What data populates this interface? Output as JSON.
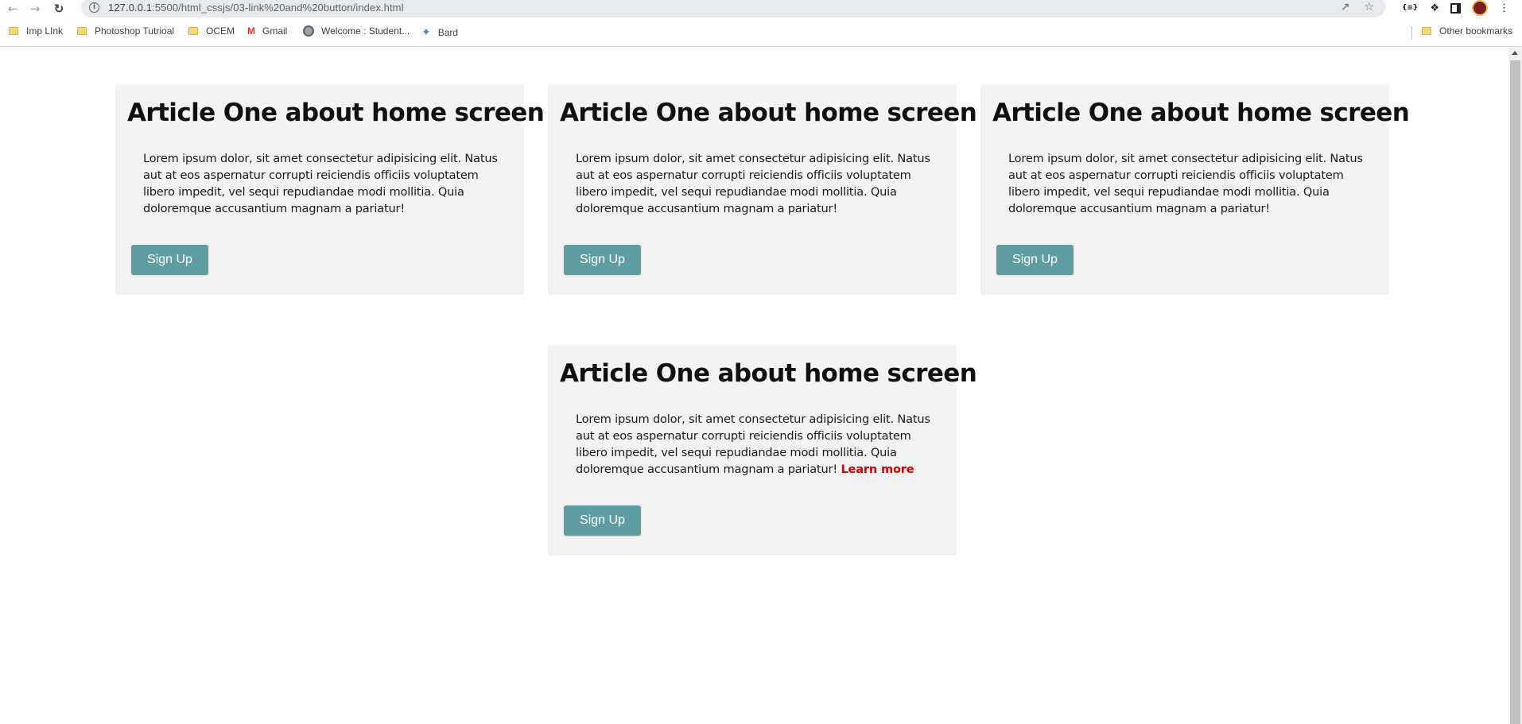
{
  "browser": {
    "url_host": "127.0.0.1",
    "url_path": ":5500/html_cssjs/03-link%20and%20button/index.html",
    "bookmarks": [
      {
        "label": "Imp LInk",
        "icon": "folder-icon"
      },
      {
        "label": "Photoshop Tutrioal",
        "icon": "folder-icon"
      },
      {
        "label": "OCEM",
        "icon": "folder-icon"
      },
      {
        "label": "Gmail",
        "icon": "gmail-icon"
      },
      {
        "label": "Welcome : Student...",
        "icon": "globe-icon"
      },
      {
        "label": "Bard",
        "icon": "bard-icon"
      }
    ],
    "other_bookmarks": "Other bookmarks",
    "extension_label": "{≡}"
  },
  "cards": [
    {
      "title": "Article One about home screen",
      "text": "Lorem ipsum dolor, sit amet consectetur adipisicing elit. Natus aut at eos aspernatur corrupti reiciendis officiis voluptatem libero impedit, vel sequi repudiandae modi mollitia. Quia doloremque accusantium magnam a pariatur!",
      "link": "",
      "button": "Sign Up"
    },
    {
      "title": "Article One about home screen",
      "text": "Lorem ipsum dolor, sit amet consectetur adipisicing elit. Natus aut at eos aspernatur corrupti reiciendis officiis voluptatem libero impedit, vel sequi repudiandae modi mollitia. Quia doloremque accusantium magnam a pariatur!",
      "link": "",
      "button": "Sign Up"
    },
    {
      "title": "Article One about home screen",
      "text": "Lorem ipsum dolor, sit amet consectetur adipisicing elit. Natus aut at eos aspernatur corrupti reiciendis officiis voluptatem libero impedit, vel sequi repudiandae modi mollitia. Quia doloremque accusantium magnam a pariatur!",
      "link": "",
      "button": "Sign Up"
    },
    {
      "title": "Article One about home screen",
      "text": "Lorem ipsum dolor, sit amet consectetur adipisicing elit. Natus aut at eos aspernatur corrupti reiciendis officiis voluptatem libero impedit, vel sequi repudiandae modi mollitia. Quia doloremque accusantium magnam a pariatur!",
      "link": "Learn more",
      "button": "Sign Up"
    }
  ],
  "colors": {
    "card_background": "#f3f3f3",
    "button_background": "#5f9ea0",
    "link_color": "#d50000"
  }
}
